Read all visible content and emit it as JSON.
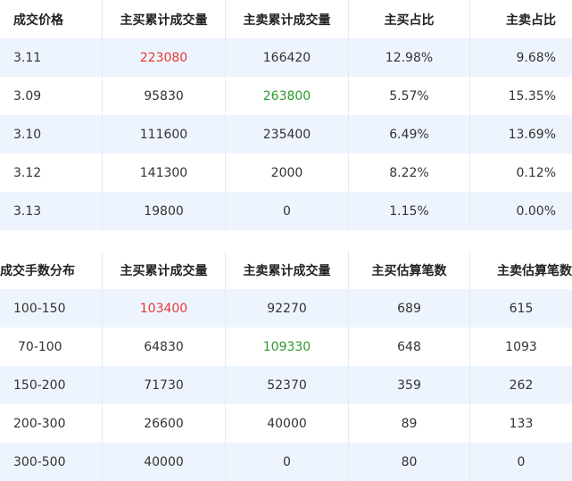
{
  "price_table": {
    "headers": [
      "成交价格",
      "主买累计成交量",
      "主卖累计成交量",
      "主买占比",
      "主卖占比"
    ],
    "rows": [
      [
        "3.11",
        "223080",
        "166420",
        "12.98%",
        "9.68%"
      ],
      [
        "3.09",
        "95830",
        "263800",
        "5.57%",
        "15.35%"
      ],
      [
        "3.10",
        "111600",
        "235400",
        "6.49%",
        "13.69%"
      ],
      [
        "3.12",
        "141300",
        "2000",
        "8.22%",
        "0.12%"
      ],
      [
        "3.13",
        "19800",
        "0",
        "1.15%",
        "0.00%"
      ]
    ]
  },
  "lot_table": {
    "headers": [
      "成交手数分布",
      "主买累计成交量",
      "主卖累计成交量",
      "主买估算笔数",
      "主卖估算笔数"
    ],
    "rows": [
      [
        "100-150",
        "103400",
        "92270",
        "689",
        "615"
      ],
      [
        "70-100",
        "64830",
        "109330",
        "648",
        "1093"
      ],
      [
        "150-200",
        "71730",
        "52370",
        "359",
        "262"
      ],
      [
        "200-300",
        "26600",
        "40000",
        "89",
        "133"
      ],
      [
        "300-500",
        "40000",
        "0",
        "80",
        "0"
      ]
    ]
  },
  "colors": {
    "highlight_buy": "#e53935",
    "highlight_sell": "#2e9b2e",
    "row_stripe": "#eef4fd"
  }
}
